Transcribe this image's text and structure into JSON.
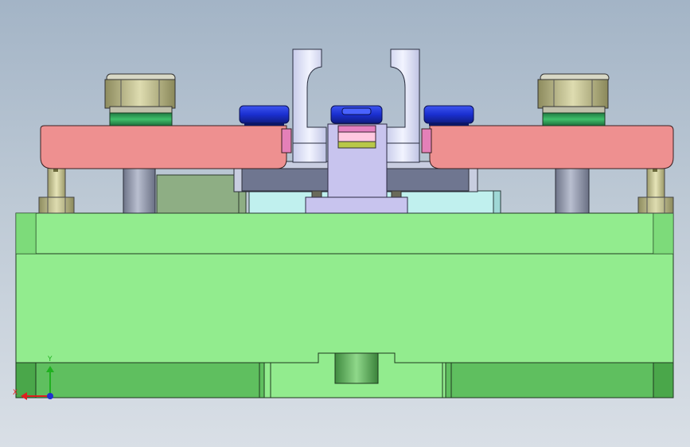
{
  "viewport": {
    "background_top": "#a3b4c6",
    "background_bottom": "#d9dfe6"
  },
  "triad": {
    "x_label": "X",
    "y_label": "Y",
    "x_color": "#e02020",
    "y_color": "#20b020",
    "z_color": "#2030d0"
  },
  "colors": {
    "die_shoe": "#92ec8e",
    "die_shoe_dark": "#5fbf5f",
    "stripper_plate": "#ee9090",
    "blue_part": "#1a2fd0",
    "nut": "#c8c89a",
    "green_washer": "#2f9f5a",
    "guide_post": "#8c94a8",
    "bracket": "#e4e8ff",
    "punch_holder": "#c8c4ee",
    "cyan_block": "#c0f0ee"
  }
}
